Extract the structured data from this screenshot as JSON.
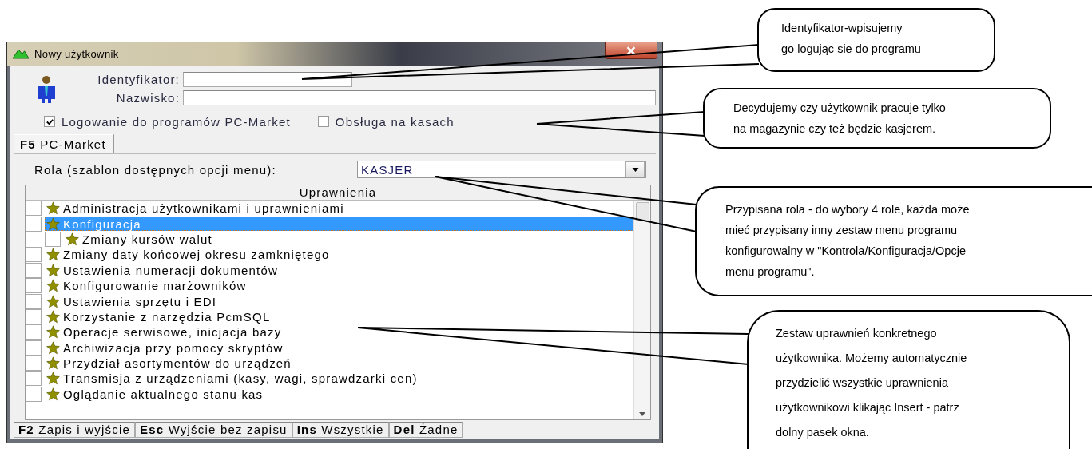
{
  "window": {
    "title": "Nowy użytkownik"
  },
  "fields": [
    {
      "label": "Identyfikator:",
      "kind": "short"
    },
    {
      "label": "Nazwisko:",
      "kind": "full"
    }
  ],
  "options": [
    {
      "label": "Logowanie do programów PC-Market",
      "checked": true
    },
    {
      "label": "Obsługa na kasach",
      "checked": false
    }
  ],
  "tabs": [
    {
      "label": "**F5**  PC-Market",
      "selected": true
    }
  ],
  "role": {
    "label": "Rola (szablon dostępnych opcji menu):",
    "value": "KASJER"
  },
  "permissions": {
    "header": "Uprawnienia",
    "items": [
      {
        "label": "Administracja użytkownikami i uprawnieniami",
        "checked": false,
        "selected": false
      },
      {
        "label": "Konfiguracja",
        "checked": false,
        "selected": true,
        "children": [
          {
            "label": "Zmiany kursów walut",
            "checked": false,
            "selected": false
          }
        ]
      },
      {
        "label": "Zmiany daty końcowej okresu zamkniętego",
        "checked": false,
        "selected": false
      },
      {
        "label": "Ustawienia numeracji dokumentów",
        "checked": false,
        "selected": false
      },
      {
        "label": "Konfigurowanie marżowników",
        "checked": false,
        "selected": false
      },
      {
        "label": "Ustawienia sprzętu i EDI",
        "checked": false,
        "selected": false
      },
      {
        "label": "Korzystanie z narzędzia PcmSQL",
        "checked": false,
        "selected": false
      },
      {
        "label": "Operacje serwisowe, inicjacja bazy",
        "checked": false,
        "selected": false
      },
      {
        "label": "Archiwizacja przy pomocy skryptów",
        "checked": false,
        "selected": false
      },
      {
        "label": "Przydział asortymentów do urządzeń",
        "checked": false,
        "selected": false
      },
      {
        "label": "Transmisja z urządzeniami (kasy, wagi, sprawdzarki cen)",
        "checked": false,
        "selected": false
      },
      {
        "label": "Oglądanie aktualnego stanu kas",
        "checked": false,
        "selected": false
      }
    ]
  },
  "status_bar": [
    "**F2**  Zapis i wyjście",
    "**Esc**  Wyjście bez zapisu",
    "**Ins**  Wszystkie",
    "**Del**  Żadne"
  ],
  "callouts": [
    {
      "lines": [
        "Identyfikator-wpisujemy",
        "go logując sie do programu"
      ]
    },
    {
      "lines": [
        "Decydujemy czy użytkownik pracuje tylko",
        "na magazynie czy też będzie kasjerem."
      ]
    },
    {
      "lines": [
        "Przypisana  rola - do wybory 4 role, każda może",
        "mieć przypisany inny zestaw menu programu",
        "konfigurowalny w  \"Kontrola/Konfiguracja/Opcje",
        "menu programu\"."
      ]
    },
    {
      "lines": [
        "Zestaw uprawnień konkretnego",
        "użytkownika. Możemy automatycznie",
        "przydzielić wszystkie uprawnienia",
        "użytkownikowi klikając Insert - patrz",
        "dolny pasek okna."
      ]
    }
  ]
}
